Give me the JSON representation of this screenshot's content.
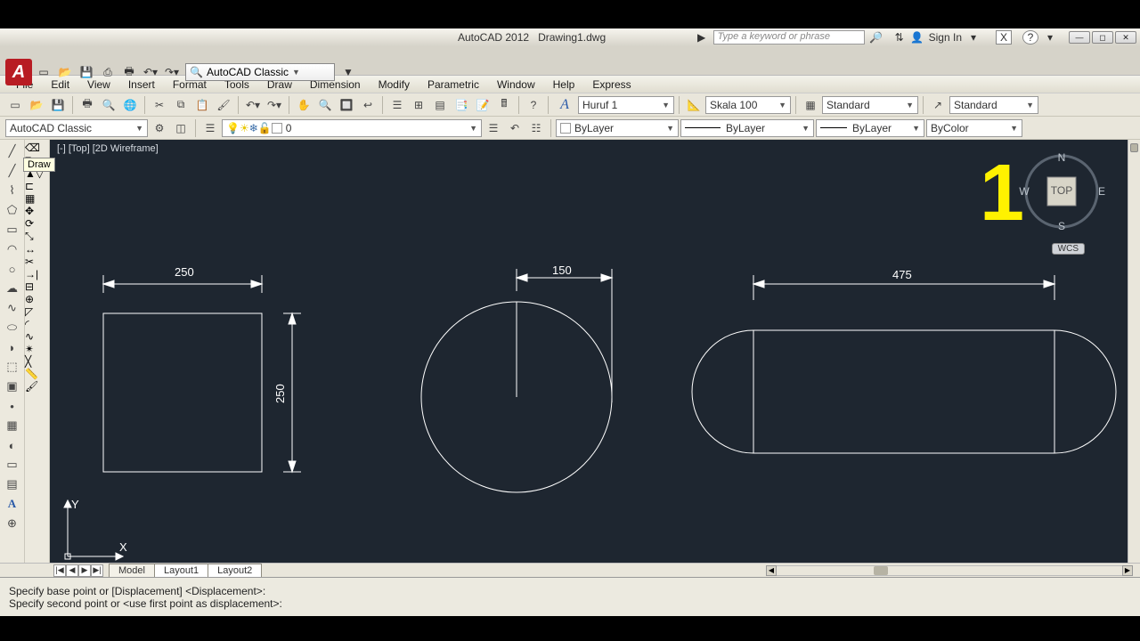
{
  "app": {
    "title": "AutoCAD 2012",
    "doc": "Drawing1.dwg"
  },
  "search_placeholder": "Type a keyword or phrase",
  "sign_in": "Sign In",
  "qat_workspace": "AutoCAD Classic",
  "menubar": [
    "File",
    "Edit",
    "View",
    "Insert",
    "Format",
    "Tools",
    "Draw",
    "Dimension",
    "Modify",
    "Parametric",
    "Window",
    "Help",
    "Express"
  ],
  "row1": {
    "text_style_icon": "A",
    "text_style": "Huruf 1",
    "dim_style": "Skala 100",
    "table_style": "Standard",
    "mleader_style": "Standard"
  },
  "row2": {
    "workspace": "AutoCAD Classic",
    "layer": "0",
    "bylayer1": "ByLayer",
    "bylayer2": "ByLayer",
    "bylayer3": "ByLayer",
    "bycolor": "ByColor"
  },
  "viewport_label": "[-] [Top] [2D Wireframe]",
  "tooltip": "Draw",
  "dims": {
    "d1": "250",
    "d2": "250",
    "d3": "150",
    "d4": "475"
  },
  "ucs": {
    "x": "X",
    "y": "Y"
  },
  "big_marker": "1",
  "compass": {
    "n": "N",
    "s": "S",
    "e": "E",
    "w": "W",
    "face": "TOP"
  },
  "wcs": "WCS",
  "tabs_nav": [
    "|◀",
    "◀",
    "▶",
    "▶|"
  ],
  "tabs": [
    "Model",
    "Layout1",
    "Layout2"
  ],
  "cmd": {
    "l1": "Specify base point or [Displacement] <Displacement>:",
    "l2": "Specify second point or <use first point as displacement>:"
  }
}
